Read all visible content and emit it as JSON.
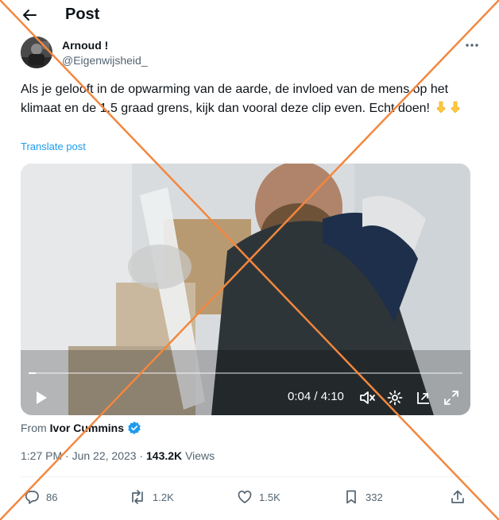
{
  "header": {
    "title": "Post"
  },
  "author": {
    "display_name": "Arnoud !",
    "handle": "@Eigenwijsheid_"
  },
  "tweet": {
    "text": "Als je gelooft in de opwarming van de aarde, de invloed van de mens op het klimaat en de 1,5 graad grens, kijk dan vooral deze clip even. Echt doen!",
    "emoji": [
      "pointing-down-emoji",
      "pointing-down-emoji"
    ],
    "translate_label": "Translate post"
  },
  "video": {
    "current_time": "0:04",
    "separator": "/",
    "duration": "4:10",
    "time_display": "0:04 / 4:10",
    "progress_fraction": 0.016
  },
  "attribution": {
    "prefix": "From",
    "source_name": "Ivor Cummins",
    "verified": true
  },
  "meta": {
    "time": "1:27 PM",
    "dot": "·",
    "date": "Jun 22, 2023",
    "views_count": "143.2K",
    "views_label": "Views"
  },
  "actions": {
    "replies": "86",
    "reposts": "1.2K",
    "likes": "1.5K",
    "bookmarks": "332"
  },
  "colors": {
    "accent": "#1d9bf0",
    "overlay_cross": "#f2873f",
    "text_primary": "#0f1419",
    "text_secondary": "#536471"
  }
}
